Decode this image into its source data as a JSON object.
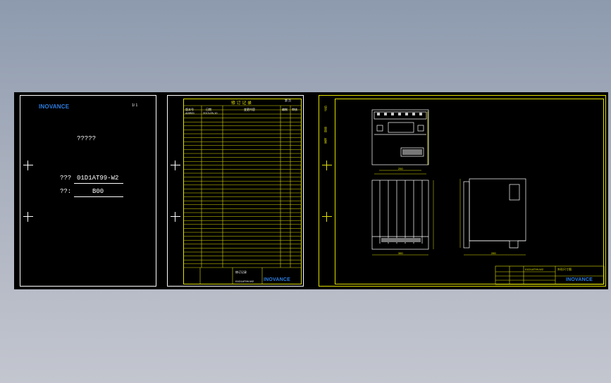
{
  "cover": {
    "logo": "INOVANCE",
    "page_no": "1/ 1",
    "title": "?????",
    "code_label": "???",
    "code_value": "01D1AT99-W2",
    "ver_label": "??:",
    "ver_value": "B00"
  },
  "record_sheet": {
    "header_title": "修 订 记 录",
    "page": "第 页",
    "col_version": "版本号",
    "col_date": "日期",
    "col_content": "变更内容",
    "col_author": "编制",
    "col_check": "审核",
    "first_row_version": "A0/B01",
    "first_row_date": "2013-05-10",
    "footer_doc": "修订记录",
    "footer_code": "01D1AT99-W2",
    "footer_logo": "INOVANCE"
  },
  "drawing_sheet": {
    "left_margin_labels": [
      "设计",
      "审核",
      "批准"
    ],
    "title_block_logo": "INOVANCE",
    "title_block_name": "外形尺寸图",
    "title_block_code": "01D1AT99-W2",
    "dim_front_width": "250",
    "dim_front_height": "380",
    "dim_side_depth": "280"
  },
  "colors": {
    "canvas": "#000000",
    "frame_white": "#ffffff",
    "frame_yellow": "#e0e000",
    "logo_blue": "#2c7de0"
  }
}
